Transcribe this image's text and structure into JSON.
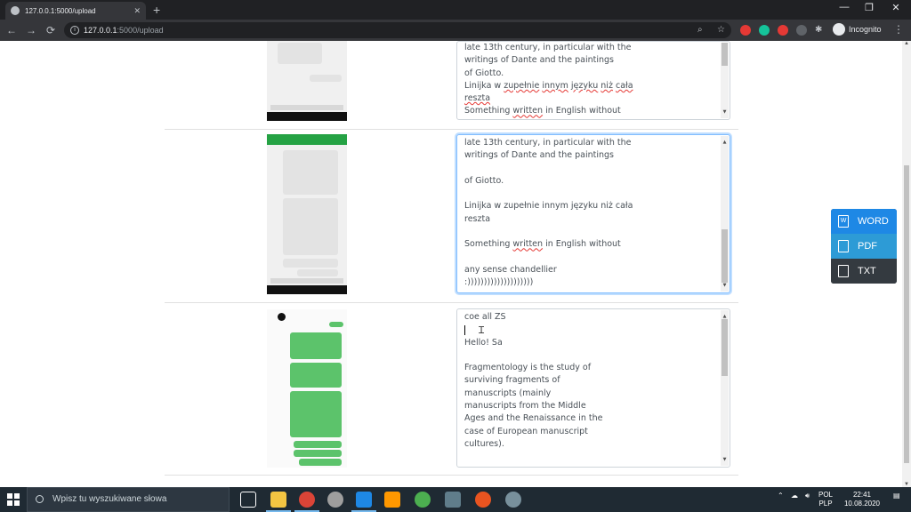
{
  "browser": {
    "tab_title": "127.0.0.1:5000/upload",
    "tab_close": "✕",
    "new_tab": "+",
    "url_host": "127.0.0.1",
    "url_path": ":5000/upload",
    "profile": "Incognito",
    "window_controls": [
      "—",
      "❐",
      "✕"
    ]
  },
  "rows": [
    {
      "lines": [
        {
          "text": "late 13th century, in particular with the"
        },
        {
          "text": "writings of Dante and the paintings"
        },
        {
          "text": "of Giotto."
        },
        {
          "parts": [
            {
              "t": "Linijka w "
            },
            {
              "t": "zupełnie",
              "s": 1
            },
            {
              "t": " "
            },
            {
              "t": "innym",
              "s": 1
            },
            {
              "t": " "
            },
            {
              "t": "języku",
              "s": 1
            },
            {
              "t": " "
            },
            {
              "t": "niż",
              "s": 1
            },
            {
              "t": " "
            },
            {
              "t": "cała",
              "s": 1
            }
          ]
        },
        {
          "parts": [
            {
              "t": "reszta",
              "s": 1
            }
          ]
        },
        {
          "parts": [
            {
              "t": "Something "
            },
            {
              "t": "written",
              "s": 1
            },
            {
              "t": " in English without"
            }
          ]
        }
      ]
    },
    {
      "lines": [
        {
          "text": "late 13th century, in particular with the"
        },
        {
          "text": "writings of Dante and the paintings"
        },
        {
          "text": ""
        },
        {
          "text": "of Giotto."
        },
        {
          "text": ""
        },
        {
          "text": "Linijka w zupełnie innym języku niż cała"
        },
        {
          "text": "reszta"
        },
        {
          "text": ""
        },
        {
          "parts": [
            {
              "t": "Something "
            },
            {
              "t": "written",
              "s": 1
            },
            {
              "t": " in English without"
            }
          ]
        },
        {
          "text": ""
        },
        {
          "text": "any sense chandellier"
        },
        {
          "text": ":))))))))))))))))))))"
        }
      ]
    },
    {
      "lines": [
        {
          "text": "coe all ZS"
        },
        {
          "text": ""
        },
        {
          "text": "Hello! Sa"
        },
        {
          "text": ""
        },
        {
          "text": "Fragmentology is the study of"
        },
        {
          "text": "surviving fragments of"
        },
        {
          "text": "manuscripts (mainly"
        },
        {
          "text": "manuscripts from the Middle"
        },
        {
          "text": "Ages and the Renaissance in the"
        },
        {
          "text": "case of European manuscript"
        },
        {
          "text": "cultures)."
        }
      ]
    }
  ],
  "export": {
    "word": "WORD",
    "word_icon": "W",
    "pdf": "PDF",
    "txt": "TXT"
  },
  "taskbar": {
    "search_placeholder": "Wpisz tu wyszukiwane słowa",
    "lang_top": "POL",
    "lang_bottom": "PLP",
    "time": "22:41",
    "date": "10.08.2020"
  }
}
